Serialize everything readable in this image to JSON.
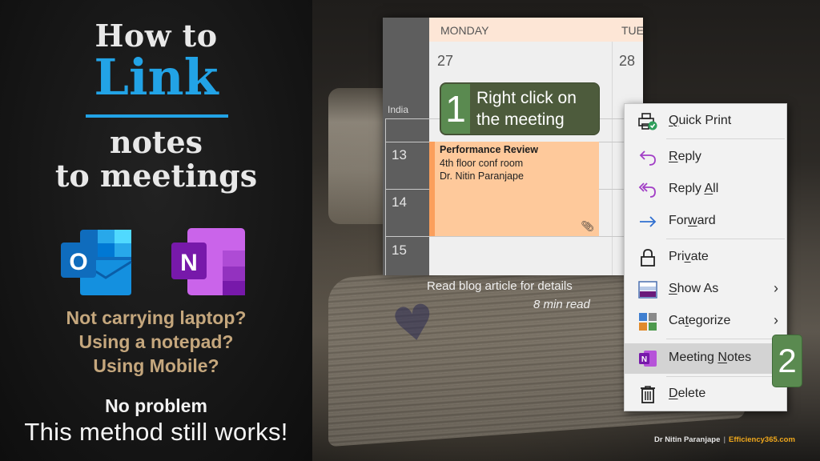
{
  "title_panel": {
    "line1": "How to",
    "line2": "Link",
    "line3": "notes",
    "line4": "to meetings",
    "app_icons": [
      {
        "name": "outlook-icon",
        "letter": "O",
        "color": "#0f6cbd"
      },
      {
        "name": "onenote-icon",
        "letter": "N",
        "color": "#7719aa"
      }
    ],
    "questions": [
      "Not carrying laptop?",
      "Using a notepad?",
      "Using Mobile?"
    ],
    "no_problem": "No problem",
    "tagline": "This method still works!"
  },
  "calendar": {
    "days": [
      {
        "name": "MONDAY",
        "date": "27"
      },
      {
        "name": "TUE",
        "date": "28"
      }
    ],
    "timezone_label": "India",
    "hours": [
      "13",
      "14",
      "15"
    ],
    "event": {
      "title": "Performance Review",
      "location": "4th floor conf room",
      "organizer": "Dr. Nitin Paranjape",
      "attachment_icon": "paperclip-icon"
    }
  },
  "step1": {
    "number": "1",
    "text": "Right click on the meeting"
  },
  "step2": {
    "number": "2"
  },
  "blog_note": {
    "text": "Read blog article for details",
    "read_time": "8 min read"
  },
  "context_menu": {
    "items": [
      {
        "label": "Quick Print",
        "accel_index": 0,
        "icon": "printer-check-icon",
        "submenu": false
      },
      {
        "label": "Reply",
        "accel_index": 0,
        "icon": "reply-icon",
        "submenu": false
      },
      {
        "label": "Reply All",
        "accel_index": 6,
        "icon": "reply-all-icon",
        "submenu": false
      },
      {
        "label": "Forward",
        "accel_index": 3,
        "icon": "forward-icon",
        "submenu": false
      },
      {
        "label": "Private",
        "accel_index": 3,
        "icon": "lock-icon",
        "submenu": false
      },
      {
        "label": "Show As",
        "accel_index": 0,
        "icon": "show-as-icon",
        "submenu": true
      },
      {
        "label": "Categorize",
        "accel_index": 2,
        "icon": "categorize-icon",
        "submenu": true
      },
      {
        "label": "Meeting Notes",
        "accel_index": 8,
        "icon": "onenote-icon",
        "submenu": false,
        "highlighted": true
      },
      {
        "label": "Delete",
        "accel_index": 0,
        "icon": "trash-icon",
        "submenu": false
      }
    ]
  },
  "credit": {
    "author": "Dr Nitin Paranjape",
    "separator": "|",
    "site": "Efficiency365.com"
  },
  "colors": {
    "link_blue": "#22a3e6",
    "question_tan": "#c5a77d",
    "step_green": "#5a8a50",
    "event_orange": "#fec99b",
    "site_orange": "#f0a81c"
  }
}
